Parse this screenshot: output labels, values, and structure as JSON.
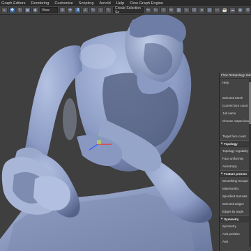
{
  "menubar": {
    "items": [
      "Graph Editors",
      "Rendering",
      "Customize",
      "Scripting",
      "Arnold",
      "Help",
      "Flow Graph Engine"
    ]
  },
  "toolbar": {
    "view_select": "View",
    "selection_set": "Create Selection Se"
  },
  "panel": {
    "title": "Flow Retopology Subm",
    "rows": [
      {
        "kind": "row",
        "label": "Help"
      },
      {
        "kind": "row",
        "label": ""
      },
      {
        "kind": "row",
        "label": "Selected Mesh"
      },
      {
        "kind": "row",
        "label": "Current face count"
      },
      {
        "kind": "row",
        "label": "Job name"
      },
      {
        "kind": "row",
        "label": "Choose output locatio"
      },
      {
        "kind": "row",
        "label": ""
      },
      {
        "kind": "row",
        "label": "Target face count"
      },
      {
        "kind": "sec",
        "label": "Topology"
      },
      {
        "kind": "row",
        "label": "Topology regularity"
      },
      {
        "kind": "row",
        "label": "Face uniformity"
      },
      {
        "kind": "row",
        "label": "Anisotropy"
      },
      {
        "kind": "sec",
        "label": "Feature preserv"
      },
      {
        "kind": "row",
        "label": "Smoothing Groups"
      },
      {
        "kind": "row",
        "label": "Material IDs"
      },
      {
        "kind": "row",
        "label": "Specified Normals"
      },
      {
        "kind": "row",
        "label": "Selected Edges"
      },
      {
        "kind": "row",
        "label": "Edges by angle"
      },
      {
        "kind": "sec",
        "label": "Symmetry"
      },
      {
        "kind": "row",
        "label": "Symmetry"
      },
      {
        "kind": "row",
        "label": "Axis position"
      },
      {
        "kind": "row",
        "label": "Axis"
      }
    ]
  },
  "colors": {
    "model": "#8fa0c8",
    "model_shadow": "#4e5a7a",
    "gizmo_x": "#e04040",
    "gizmo_y": "#40d040",
    "gizmo_z": "#4060ff"
  }
}
